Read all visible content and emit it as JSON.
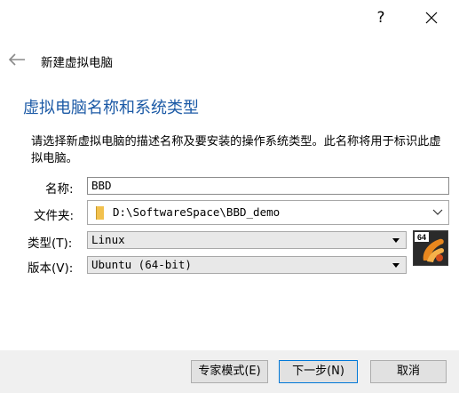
{
  "window": {
    "help_label": "?",
    "close_label": "×"
  },
  "wizard": {
    "title": "新建虚拟电脑"
  },
  "section": {
    "heading": "虚拟电脑名称和系统类型",
    "description": "请选择新虚拟电脑的描述名称及要安装的操作系统类型。此名称将用于标识此虚拟电脑。"
  },
  "form": {
    "name_label": "名称:",
    "name_value": "BBD",
    "folder_label": "文件夹:",
    "folder_value": "D:\\SoftwareSpace\\BBD_demo",
    "type_label": "类型(T):",
    "type_value": "Linux",
    "version_label": "版本(V):",
    "version_value": "Ubuntu (64-bit)",
    "os_badge": "64",
    "os_icon": "ubuntu-64-icon"
  },
  "buttons": {
    "expert": "专家模式(E)",
    "next": "下一步(N)",
    "cancel": "取消"
  },
  "colors": {
    "heading": "#1c5aa6",
    "focus_border": "#0078d7"
  }
}
